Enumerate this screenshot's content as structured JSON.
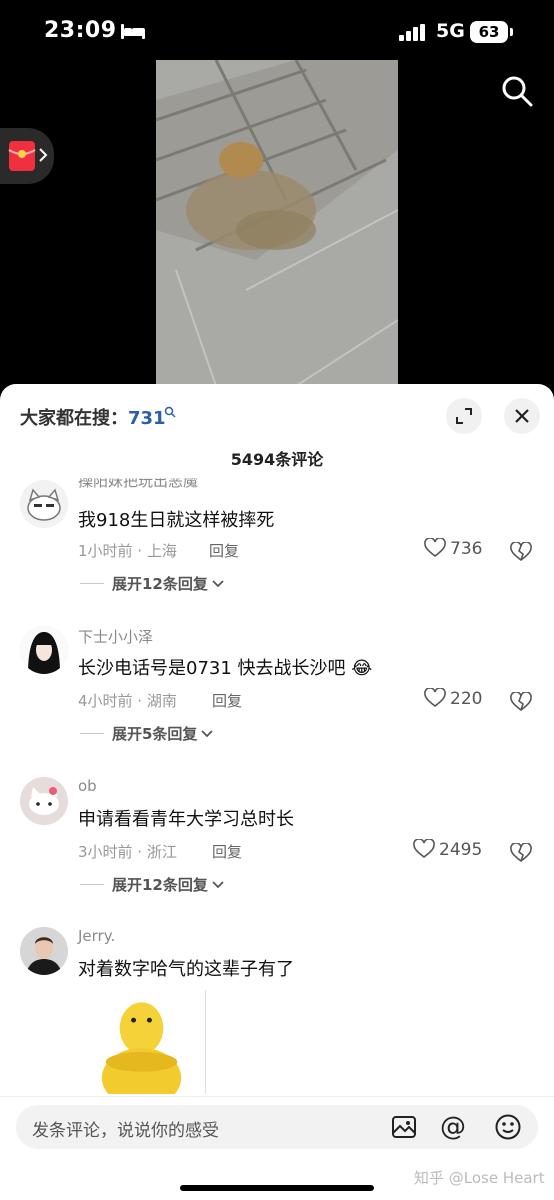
{
  "status_bar": {
    "time": "23:09",
    "network": "5G",
    "battery": "63"
  },
  "icons": {
    "bed": "bed-icon",
    "signal": "signal-icon",
    "search": "search-icon",
    "red_packet": "red-packet-icon",
    "expand": "expand-icon",
    "close": "close-icon",
    "heart": "heart-icon",
    "dislike": "broken-heart-icon",
    "chevron": "chevron-down-icon",
    "image": "image-icon",
    "at": "at-icon",
    "emoji": "emoji-icon"
  },
  "sheet": {
    "search_label": "大家都在搜：",
    "search_keyword": "731",
    "comment_count": "5494条评论"
  },
  "comments": [
    {
      "username": "操阳妹把玩出恶魔",
      "text": "我918生日就这样被摔死",
      "meta": "1小时前 · 上海",
      "reply": "回复",
      "likes": "736",
      "expand": "展开12条回复"
    },
    {
      "username": "下士小小泽",
      "text": "长沙电话号是0731 快去战长沙吧",
      "emoji": "😂",
      "meta": "4小时前 · 湖南",
      "reply": "回复",
      "likes": "220",
      "expand": "展开5条回复"
    },
    {
      "username": "ob",
      "text": "申请看看青年大学习总时长",
      "meta": "3小时前 · 浙江",
      "reply": "回复",
      "likes": "2495",
      "expand": "展开12条回复"
    },
    {
      "username": "Jerry.",
      "text": "对着数字哈气的这辈子有了"
    }
  ],
  "input": {
    "placeholder": "发条评论，说说你的感受",
    "at_symbol": "@"
  },
  "watermark": "知乎 @Lose Heart",
  "colors": {
    "accent_blue": "#2d5ea8",
    "sheet_bg": "#ffffff",
    "muted": "#999999"
  }
}
